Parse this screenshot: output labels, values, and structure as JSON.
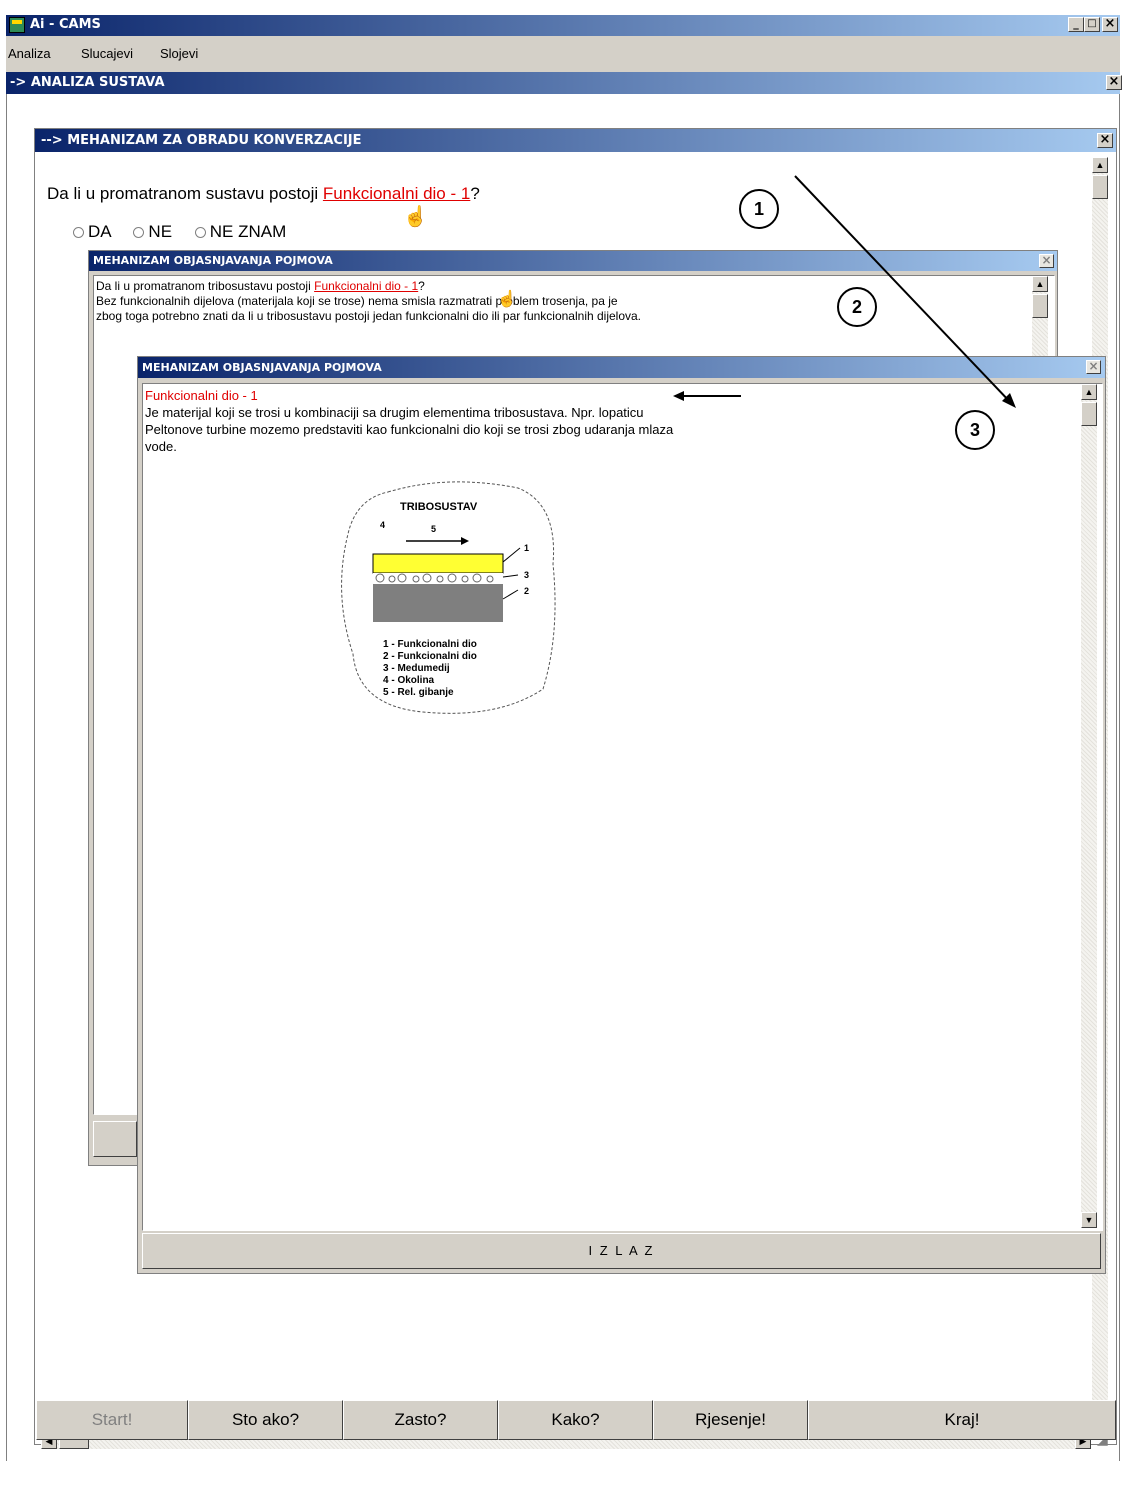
{
  "app": {
    "title": "Ai - CAMS"
  },
  "menu": [
    "Analiza",
    "Slucajevi",
    "Slojevi"
  ],
  "mdi": {
    "title": "-> ANALIZA SUSTAVA"
  },
  "conv": {
    "title": "--> MEHANIZAM ZA OBRADU KONVERZACIJE",
    "question_pre": "Da li u promatranom sustavu postoji ",
    "question_link": "Funkcionalni dio - 1",
    "question_post": "?",
    "options": [
      "DA",
      "NE",
      "NE ZNAM"
    ]
  },
  "explain1": {
    "title": "MEHANIZAM OBJASNJAVANJA POJMOVA",
    "line1_pre": "Da li u promatranom tribosustavu postoji ",
    "line1_link": "Funkcionalni dio - 1",
    "line1_post": "?",
    "line2": "Bez funkcionalnih dijelova (materijala koji se trose) nema smisla razmatrati problem trosenja, pa je",
    "line3": "zbog toga potrebno znati da li u tribosustavu postoji jedan funkcionalni dio ili par funkcionalnih dijelova."
  },
  "explain2": {
    "title": "MEHANIZAM OBJASNJAVANJA POJMOVA",
    "term": "Funkcionalni dio - 1",
    "line1": "Je materijal koji se trosi u kombinaciji sa drugim elementima tribosustava. Npr. lopaticu",
    "line2": "Peltonove turbine mozemo predstaviti kao funkcionalni dio koji se trosi zbog udaranja mlaza",
    "line3": "vode.",
    "exit_label": "I Z L A Z",
    "diagram": {
      "title": "TRIBOSUSTAV",
      "n1": "1",
      "n2": "2",
      "n3": "3",
      "n4": "4",
      "n5": "5",
      "legend": [
        "1 - Funkcionalni dio",
        "2 - Funkcionalni dio",
        "3 - Medumedij",
        "4 - Okolina",
        "5 - Rel. gibanje"
      ],
      "colors": {
        "top": "#ffff33",
        "bottom": "#7f7f7f"
      }
    }
  },
  "callouts": [
    "1",
    "2",
    "3"
  ],
  "buttons": [
    "Start!",
    "Sto ako?",
    "Zasto?",
    "Kako?",
    "Rjesenje!",
    "Kraj!"
  ],
  "titlebar_controls": {
    "minimize": "_",
    "maximize": "□",
    "close": "×"
  }
}
